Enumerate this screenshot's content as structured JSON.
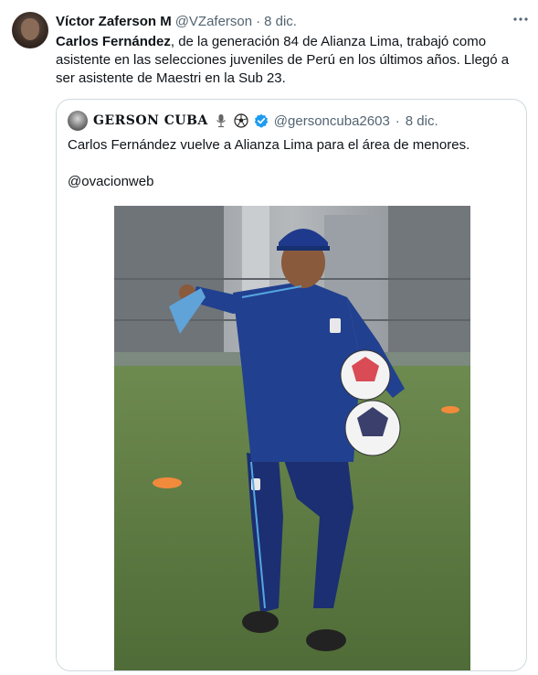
{
  "tweet": {
    "author_name": "Víctor Zaferson M",
    "author_handle": "@VZaferson",
    "separator": "·",
    "time": "8 dic.",
    "more_icon": "more-horizontal-icon",
    "text_bold": "Carlos Fernández",
    "text_rest": ", de la generación 84 de Alianza Lima, trabajó como asistente en las selecciones juveniles de Perú en los últimos años. Llegó a ser asistente de Maestri en la Sub 23."
  },
  "quoted": {
    "author_name": "GERSON CUBA",
    "author_handle": "@gersoncuba2603",
    "separator": "·",
    "time": "8 dic.",
    "badges": [
      "microphone-icon",
      "soccer-ball-icon",
      "verified-badge-icon"
    ],
    "verified_color": "#1d9bf0",
    "text_line1": "Carlos Fernández vuelve a Alianza Lima para el área de menores.",
    "text_line2": "@ovacionweb"
  },
  "colors": {
    "text": "#0f1419",
    "muted": "#536471",
    "border": "#cfd9de",
    "jacket": "#1f3a8c",
    "pitch": "#5e7a44"
  }
}
